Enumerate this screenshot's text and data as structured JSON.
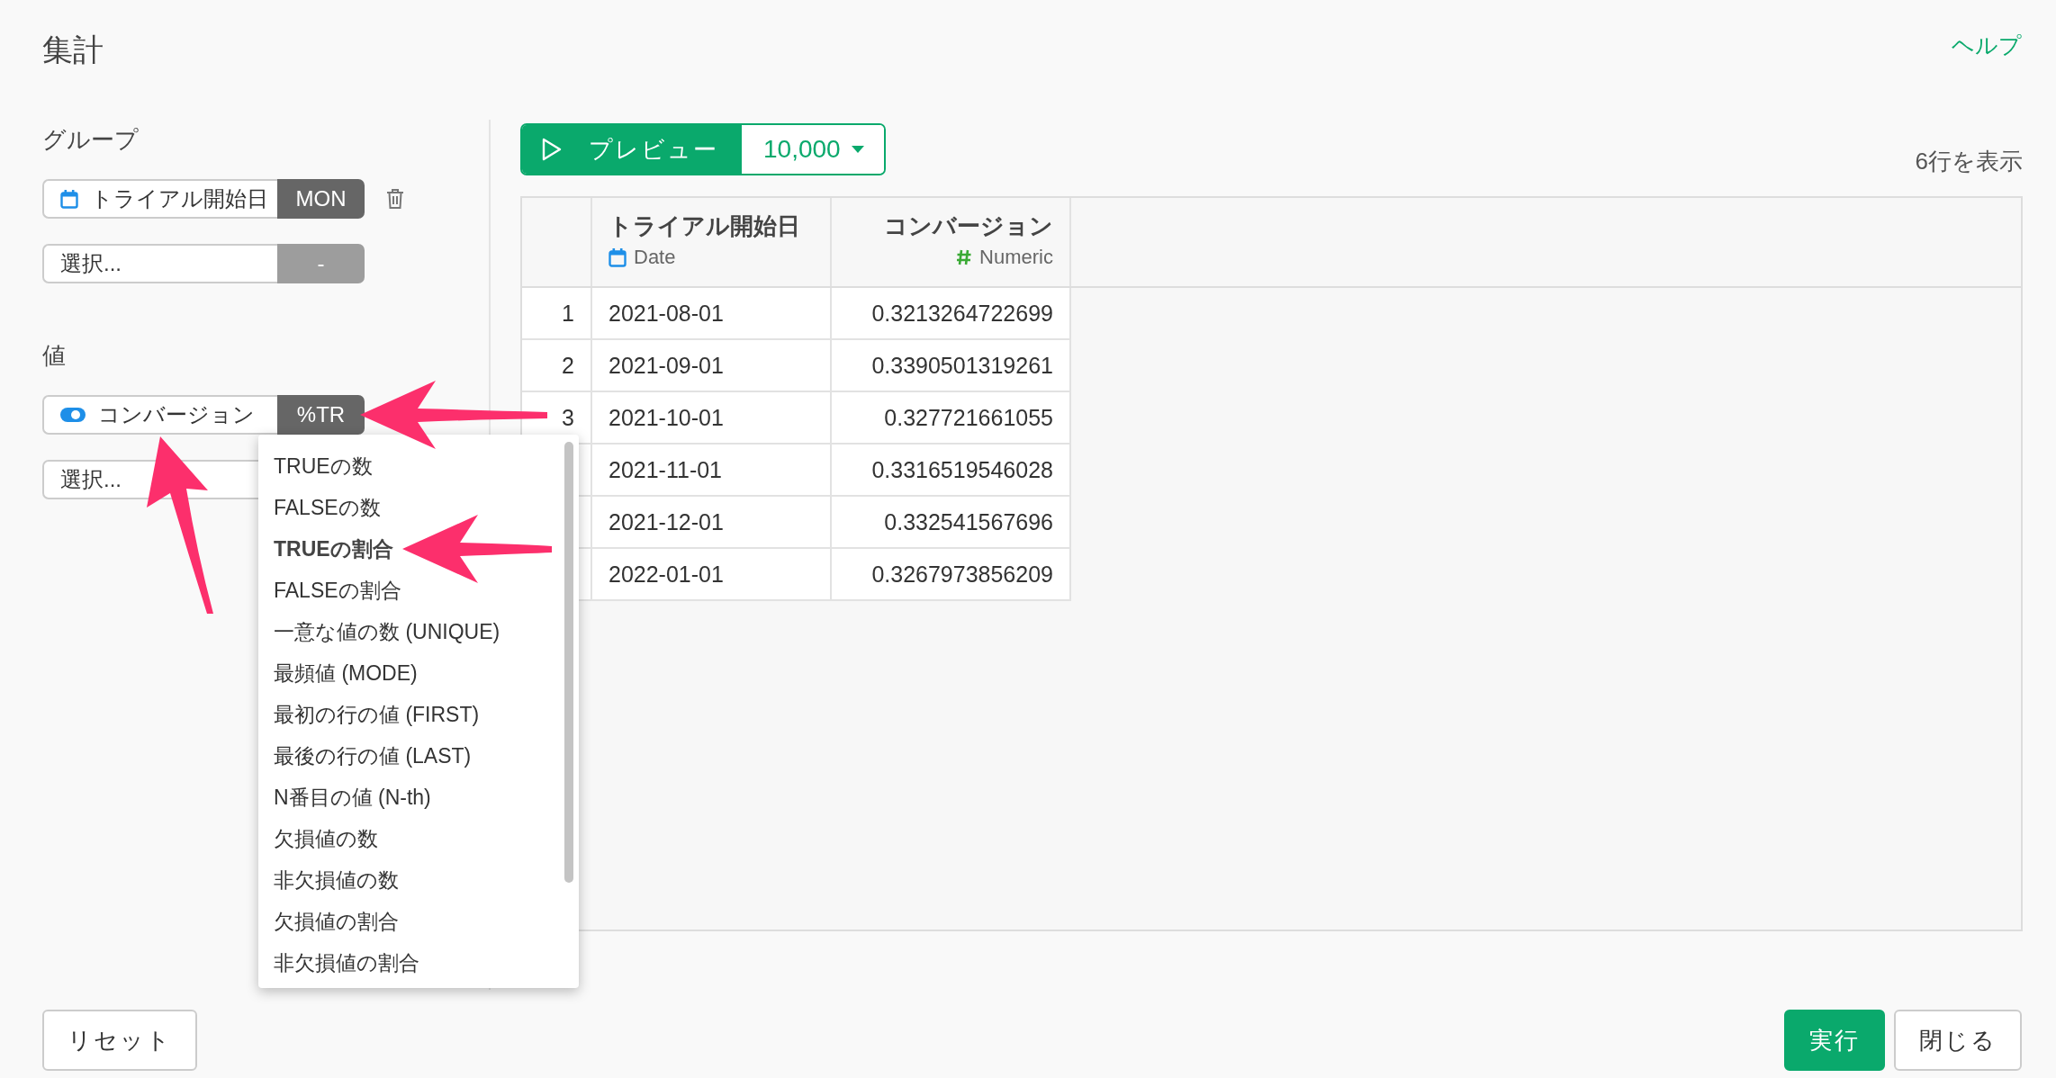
{
  "title": "集計",
  "help": "ヘルプ",
  "group": {
    "label": "グループ",
    "items": [
      {
        "kind": "date",
        "name": "トライアル開始日",
        "func": "MON",
        "removable": true
      },
      {
        "kind": "empty",
        "placeholder": "選択...",
        "func": "-"
      }
    ]
  },
  "values": {
    "label": "値",
    "items": [
      {
        "kind": "logical",
        "name": "コンバージョン",
        "func": "%TR"
      },
      {
        "kind": "empty",
        "placeholder": "選択..."
      }
    ]
  },
  "menu": {
    "items": [
      {
        "label": "TRUEの数",
        "selected": false
      },
      {
        "label": "FALSEの数",
        "selected": false
      },
      {
        "label": "TRUEの割合",
        "selected": true
      },
      {
        "label": "FALSEの割合",
        "selected": false
      },
      {
        "label": "一意な値の数 (UNIQUE)",
        "selected": false
      },
      {
        "label": "最頻値 (MODE)",
        "selected": false
      },
      {
        "label": "最初の行の値 (FIRST)",
        "selected": false
      },
      {
        "label": "最後の行の値 (LAST)",
        "selected": false
      },
      {
        "label": "N番目の値 (N-th)",
        "selected": false
      },
      {
        "label": "欠損値の数",
        "selected": false
      },
      {
        "label": "非欠損値の数",
        "selected": false
      },
      {
        "label": "欠損値の割合",
        "selected": false
      },
      {
        "label": "非欠損値の割合",
        "selected": false
      }
    ]
  },
  "preview": {
    "label": "プレビュー",
    "count": "10,000",
    "rows_shown": "6行を表示"
  },
  "table": {
    "columns": [
      {
        "name": "トライアル開始日",
        "kind": "date",
        "type_label": "Date"
      },
      {
        "name": "コンバージョン",
        "kind": "numeric",
        "type_label": "Numeric"
      }
    ],
    "rows": [
      {
        "num": "1",
        "cells": [
          "2021-08-01",
          "0.3213264722699"
        ]
      },
      {
        "num": "2",
        "cells": [
          "2021-09-01",
          "0.3390501319261"
        ]
      },
      {
        "num": "3",
        "cells": [
          "2021-10-01",
          "0.327721661055"
        ]
      },
      {
        "cells": [
          "2021-11-01",
          "0.3316519546028"
        ]
      },
      {
        "cells": [
          "2021-12-01",
          "0.332541567696"
        ]
      },
      {
        "cells": [
          "2022-01-01",
          "0.3267973856209"
        ]
      }
    ]
  },
  "arrows": [
    {
      "kind": "left"
    },
    {
      "kind": "up"
    },
    {
      "kind": "left"
    }
  ],
  "buttons": {
    "reset": "リセット",
    "run": "実行",
    "close": "閉じる"
  }
}
